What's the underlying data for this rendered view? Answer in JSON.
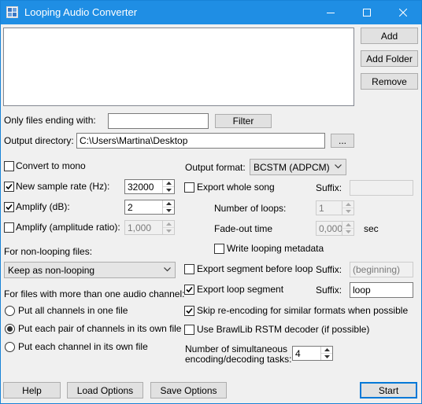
{
  "window": {
    "title": "Looping Audio Converter"
  },
  "file_buttons": {
    "add": "Add",
    "add_folder": "Add Folder",
    "remove": "Remove"
  },
  "filter": {
    "label": "Only files ending with:",
    "value": "",
    "button": "Filter"
  },
  "output_dir": {
    "label": "Output directory:",
    "value": "C:\\Users\\Martina\\Desktop",
    "browse": "..."
  },
  "options": {
    "convert_mono": {
      "label": "Convert to mono",
      "checked": false
    },
    "sample_rate": {
      "label": "New sample rate (Hz):",
      "checked": true,
      "value": "32000"
    },
    "amplify_db": {
      "label": "Amplify (dB):",
      "checked": true,
      "value": "2"
    },
    "amplify_ratio": {
      "label": "Amplify (amplitude ratio):",
      "checked": false,
      "value": "1,000"
    }
  },
  "non_looping": {
    "label": "For non-looping files:",
    "value": "Keep as non-looping"
  },
  "channels": {
    "label": "For files with more than one audio channel:",
    "options": [
      {
        "label": "Put all channels in one file",
        "selected": false
      },
      {
        "label": "Put each pair of channels in its own file",
        "selected": true
      },
      {
        "label": "Put each channel in its own file",
        "selected": false
      }
    ]
  },
  "output_format": {
    "label": "Output format:",
    "value": "BCSTM (ADPCM)"
  },
  "export_whole": {
    "label": "Export whole song",
    "checked": false,
    "suffix_label": "Suffix:",
    "suffix_value": ""
  },
  "loops": {
    "label": "Number of loops:",
    "value": "1"
  },
  "fadeout": {
    "label": "Fade-out time",
    "value": "0,000",
    "unit": "sec"
  },
  "write_meta": {
    "label": "Write looping metadata",
    "checked": false
  },
  "export_before": {
    "label": "Export segment before loop",
    "checked": false,
    "suffix_label": "Suffix:",
    "suffix_value": "(beginning)"
  },
  "export_loop": {
    "label": "Export loop segment",
    "checked": true,
    "suffix_label": "Suffix:",
    "suffix_value": "loop"
  },
  "skip_reencode": {
    "label": "Skip re-encoding for similar formats when possible",
    "checked": true
  },
  "brawllib": {
    "label": "Use BrawlLib RSTM decoder (if possible)",
    "checked": false
  },
  "tasks": {
    "label_line1": "Number of simultaneous",
    "label_line2": "encoding/decoding tasks:",
    "value": "4"
  },
  "bottom": {
    "help": "Help",
    "load": "Load Options",
    "save": "Save Options",
    "start": "Start"
  },
  "colors": {
    "titlebar": "#1f8ee4",
    "window_bg": "#f0f0f0",
    "accent": "#0078d7"
  }
}
